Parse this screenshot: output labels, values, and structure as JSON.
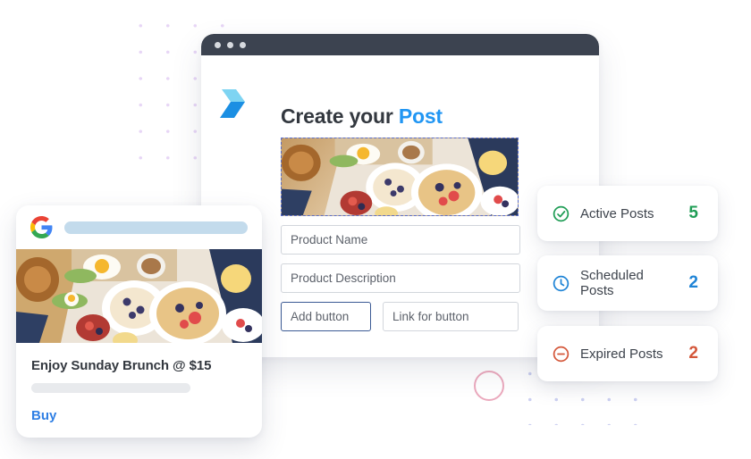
{
  "browser": {
    "window_dots": [
      "dot-1",
      "dot-2",
      "dot-3"
    ],
    "brand_logo_icon": "chevron-logo-icon",
    "headline_prefix": "Create your ",
    "headline_accent": "Post",
    "hero_image_alt": "brunch-table-photo",
    "fields": [
      {
        "name": "product-name",
        "placeholder": "Product Name",
        "value": ""
      },
      {
        "name": "product-description",
        "placeholder": "Product Description",
        "value": ""
      }
    ],
    "buttons": {
      "add_label": "Add button",
      "link_label": "Link for button"
    }
  },
  "preview_card": {
    "logo_icon": "google-logo-icon",
    "header_placeholder_bar": "",
    "image_alt": "brunch-table-photo",
    "title": "Enjoy Sunday Brunch @ $15",
    "description_bar": "",
    "cta_label": "Buy"
  },
  "stats": [
    {
      "icon": "check-circle-icon",
      "label": "Active Posts",
      "value": "5",
      "color": "#1f9d55"
    },
    {
      "icon": "clock-icon",
      "label": "Scheduled Posts",
      "value": "2",
      "color": "#1f84d6"
    },
    {
      "icon": "minus-circle-icon",
      "label": "Expired Posts",
      "value": "2",
      "color": "#d4573a"
    }
  ],
  "decor": {
    "dots_top_left_color": "#e6d4f5",
    "dots_bottom_right_color": "#c9cdf0",
    "ring_color": "#e79ab2"
  }
}
